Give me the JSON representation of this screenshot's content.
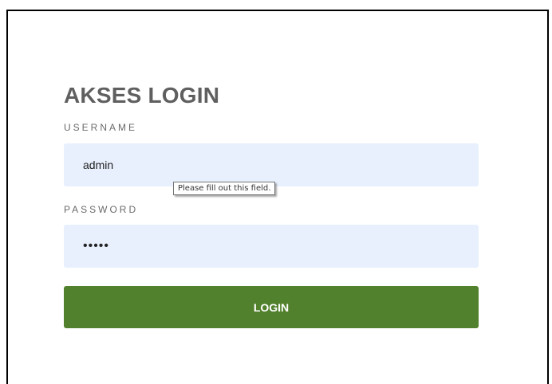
{
  "form": {
    "title": "AKSES LOGIN",
    "username": {
      "label": "USERNAME",
      "value": "admin"
    },
    "password": {
      "label": "PASSWORD",
      "value": "•••••"
    },
    "validation_tooltip": "Please fill out this field.",
    "submit_label": "LOGIN"
  },
  "colors": {
    "input_background": "#e8f0fe",
    "button_background": "#52812d",
    "title_text": "#5f5f5f"
  }
}
